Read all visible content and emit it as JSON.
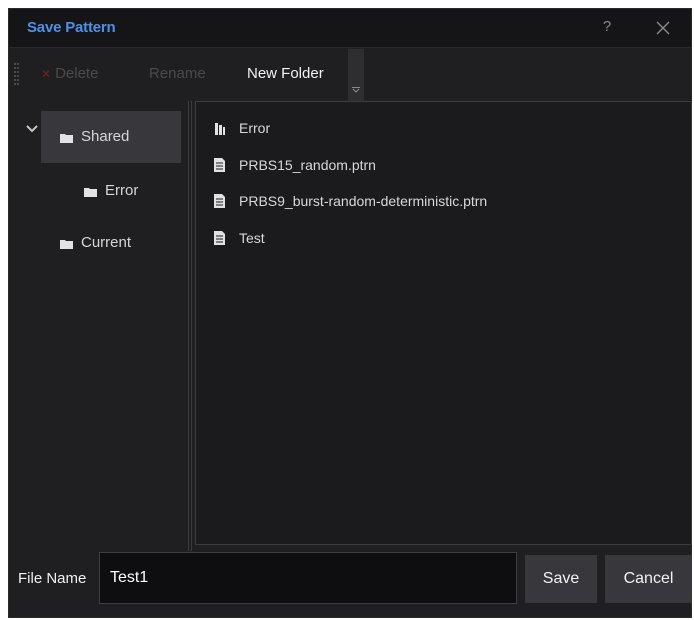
{
  "dialog": {
    "title": "Save Pattern",
    "help_label": "?",
    "close_icon": "close-icon"
  },
  "toolbar": {
    "delete_label": "Delete",
    "rename_label": "Rename",
    "new_folder_label": "New Folder"
  },
  "tree": {
    "items": [
      {
        "label": "Shared",
        "icon": "folder-icon",
        "expanded": true,
        "selected": true
      },
      {
        "label": "Error",
        "icon": "folder-icon",
        "expanded": false,
        "selected": false
      },
      {
        "label": "Current",
        "icon": "folder-icon",
        "expanded": false,
        "selected": false
      }
    ]
  },
  "files": [
    {
      "name": "Error",
      "icon": "folder-icon"
    },
    {
      "name": "PRBS15_random.ptrn",
      "icon": "file-icon"
    },
    {
      "name": "PRBS9_burst-random-deterministic.ptrn",
      "icon": "file-icon"
    },
    {
      "name": "Test",
      "icon": "file-icon"
    }
  ],
  "footer": {
    "file_name_label": "File Name",
    "file_name_value": "Test1",
    "save_label": "Save",
    "cancel_label": "Cancel"
  },
  "colors": {
    "background": "#1f1f21",
    "title": "#4f8fe6",
    "selected_row": "#38383c",
    "button": "#38383c"
  }
}
